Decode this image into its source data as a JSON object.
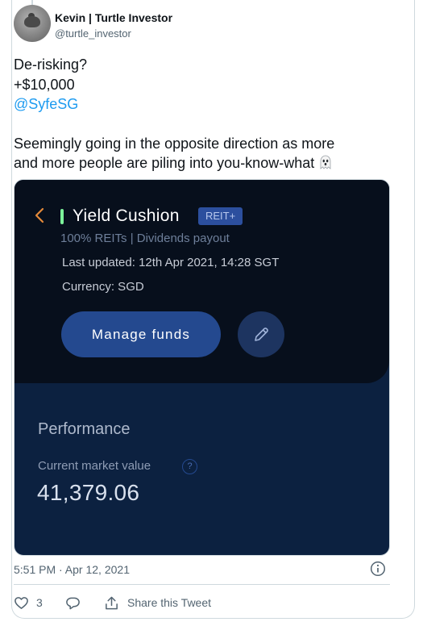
{
  "tweet": {
    "author_name": "Kevin | Turtle Investor",
    "author_handle": "@turtle_investor",
    "text_line_1": "De-risking?",
    "text_line_2": "+$10,000",
    "mention": "@SyfeSG",
    "text_line_4": "Seemingly going in the opposite direction as more",
    "text_line_5": "and more people are piling into you-know-what",
    "emoji_icon": "ghost-emoji",
    "timestamp": "5:51 PM · Apr 12, 2021",
    "like_count": "3",
    "share_label": "Share this Tweet"
  },
  "fund": {
    "back_icon": "chevron-left-icon",
    "title": "Yield Cushion",
    "badge": "REIT+",
    "subtitle": "100% REITs | Dividends payout",
    "last_updated": "Last updated: 12th Apr 2021, 14:28 SGT",
    "currency": "Currency: SGD",
    "manage_label": "Manage funds",
    "edit_icon": "pencil-icon",
    "performance_title": "Performance",
    "market_value_label": "Current market value",
    "market_value": "41,379.06",
    "help_glyph": "?"
  },
  "colors": {
    "link": "#1d9bf0",
    "app_dark": "#070f1c",
    "app_navy": "#0c2140",
    "button_blue": "#24498f",
    "accent_orange": "#e3893a",
    "accent_green": "#7cf29a"
  }
}
